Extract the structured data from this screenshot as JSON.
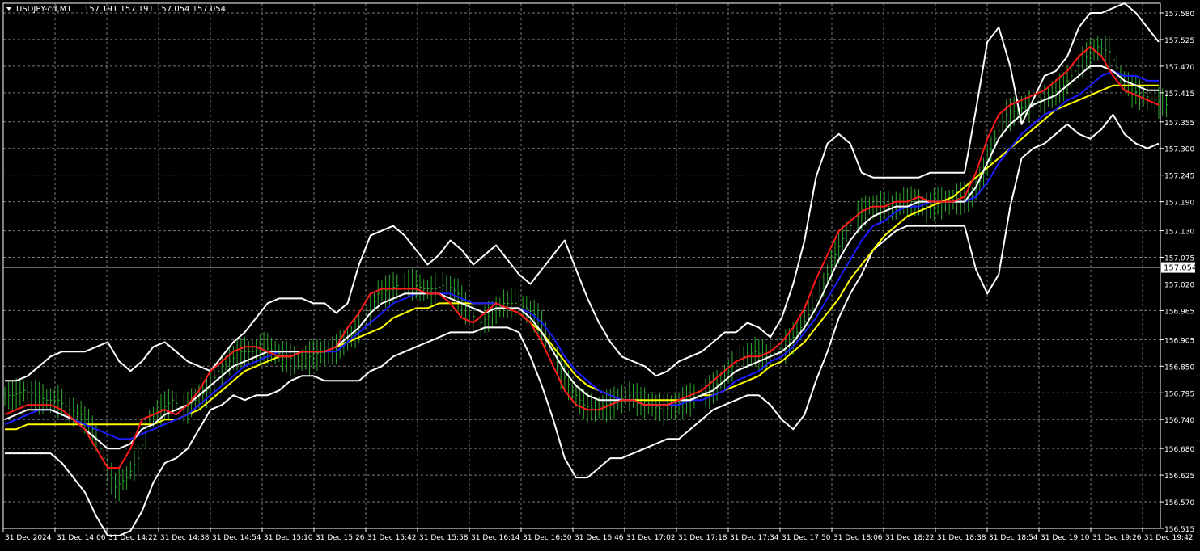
{
  "header": {
    "symbol": "USDJPY-cd,M1",
    "ohlc": "157.191 157.191 157.054 157.054"
  },
  "price_tag": "157.054",
  "colors": {
    "background": "#000000",
    "grid": "#7a7a7a",
    "candles": "#2fa82f",
    "ma_fast": "#ff1a1a",
    "ma_mid": "#ffffff",
    "ma_blue": "#1c1cff",
    "ma_slow": "#ffff00",
    "bands": "#ffffff",
    "axis_text": "#ffffff"
  },
  "chart_data": {
    "type": "line",
    "ylim": [
      156.515,
      157.6
    ],
    "y_ticks": [
      "157.580",
      "157.525",
      "157.470",
      "157.415",
      "157.355",
      "157.300",
      "157.245",
      "157.190",
      "157.130",
      "157.075",
      "157.020",
      "156.965",
      "156.905",
      "156.850",
      "156.795",
      "156.740",
      "156.680",
      "156.625",
      "156.570",
      "156.515"
    ],
    "x_ticks": [
      "31 Dec 2024",
      "31 Dec 14:06",
      "31 Dec 14:22",
      "31 Dec 14:38",
      "31 Dec 14:54",
      "31 Dec 15:10",
      "31 Dec 15:26",
      "31 Dec 15:42",
      "31 Dec 15:58",
      "31 Dec 16:14",
      "31 Dec 16:30",
      "31 Dec 16:46",
      "31 Dec 17:02",
      "31 Dec 17:18",
      "31 Dec 17:34",
      "31 Dec 17:50",
      "31 Dec 18:06",
      "31 Dec 18:22",
      "31 Dec 18:38",
      "31 Dec 18:54",
      "31 Dec 19:10",
      "31 Dec 19:26",
      "31 Dec 19:42"
    ],
    "current_price": 157.054,
    "grid": true,
    "series": [
      {
        "key": "close",
        "values": [
          156.79,
          156.8,
          156.79,
          156.78,
          156.78,
          156.76,
          156.75,
          156.72,
          156.66,
          156.6,
          156.62,
          156.66,
          156.74,
          156.76,
          156.78,
          156.76,
          156.78,
          156.8,
          156.84,
          156.86,
          156.88,
          156.88,
          156.89,
          156.88,
          156.87,
          156.86,
          156.87,
          156.88,
          156.88,
          156.9,
          156.92,
          156.95,
          157.0,
          157.01,
          157.02,
          157.02,
          157.01,
          157.01,
          157.02,
          157.0,
          156.96,
          156.94,
          156.96,
          156.98,
          156.98,
          156.97,
          156.95,
          156.9,
          156.84,
          156.8,
          156.77,
          156.76,
          156.77,
          156.78,
          156.79,
          156.78,
          156.77,
          156.76,
          156.77,
          156.78,
          156.79,
          156.8,
          156.82,
          156.85,
          156.87,
          156.88,
          156.87,
          156.88,
          156.9,
          156.93,
          156.97,
          157.02,
          157.08,
          157.13,
          157.16,
          157.18,
          157.18,
          157.18,
          157.19,
          157.19,
          157.18,
          157.19,
          157.19,
          157.2,
          157.2,
          157.25,
          157.32,
          157.37,
          157.38,
          157.39,
          157.4,
          157.41,
          157.43,
          157.46,
          157.49,
          157.51,
          157.5,
          157.45,
          157.42,
          157.41,
          157.4,
          157.39
        ]
      },
      {
        "key": "ma_fast",
        "name": "",
        "values": [
          156.75,
          156.76,
          156.77,
          156.77,
          156.77,
          156.76,
          156.74,
          156.72,
          156.68,
          156.64,
          156.64,
          156.68,
          156.74,
          156.75,
          156.76,
          156.75,
          156.77,
          156.8,
          156.84,
          156.86,
          156.88,
          156.89,
          156.89,
          156.88,
          156.87,
          156.87,
          156.88,
          156.88,
          156.88,
          156.89,
          156.93,
          156.96,
          157.0,
          157.01,
          157.01,
          157.01,
          157.01,
          157.0,
          157.0,
          156.98,
          156.95,
          156.94,
          156.96,
          156.98,
          156.97,
          156.96,
          156.94,
          156.9,
          156.85,
          156.8,
          156.77,
          156.76,
          156.76,
          156.77,
          156.78,
          156.78,
          156.77,
          156.77,
          156.77,
          156.78,
          156.79,
          156.8,
          156.82,
          156.84,
          156.86,
          156.87,
          156.87,
          156.88,
          156.9,
          156.93,
          156.97,
          157.03,
          157.08,
          157.13,
          157.15,
          157.17,
          157.18,
          157.18,
          157.19,
          157.19,
          157.2,
          157.19,
          157.19,
          157.19,
          157.2,
          157.25,
          157.32,
          157.37,
          157.39,
          157.4,
          157.41,
          157.42,
          157.44,
          157.46,
          157.49,
          157.51,
          157.49,
          157.45,
          157.42,
          157.41,
          157.4,
          157.39
        ]
      },
      {
        "key": "ma_mid",
        "name": "",
        "values": [
          156.74,
          156.75,
          156.76,
          156.76,
          156.76,
          156.75,
          156.74,
          156.72,
          156.7,
          156.68,
          156.68,
          156.69,
          156.72,
          156.73,
          156.75,
          156.76,
          156.77,
          156.79,
          156.81,
          156.83,
          156.85,
          156.86,
          156.87,
          156.88,
          156.88,
          156.88,
          156.88,
          156.88,
          156.88,
          156.89,
          156.91,
          156.93,
          156.96,
          156.98,
          156.99,
          157.0,
          157.0,
          157.0,
          157.0,
          156.99,
          156.98,
          156.97,
          156.96,
          156.97,
          156.97,
          156.97,
          156.95,
          156.92,
          156.88,
          156.84,
          156.81,
          156.79,
          156.78,
          156.78,
          156.78,
          156.78,
          156.77,
          156.77,
          156.77,
          156.78,
          156.78,
          156.79,
          156.8,
          156.82,
          156.84,
          156.85,
          156.86,
          156.87,
          156.88,
          156.9,
          156.93,
          156.97,
          157.02,
          157.07,
          157.11,
          157.14,
          157.16,
          157.17,
          157.18,
          157.18,
          157.19,
          157.19,
          157.19,
          157.19,
          157.19,
          157.22,
          157.27,
          157.32,
          157.35,
          157.37,
          157.39,
          157.4,
          157.41,
          157.43,
          157.45,
          157.47,
          157.47,
          157.46,
          157.44,
          157.43,
          157.42,
          157.42
        ]
      },
      {
        "key": "ma_blue",
        "name": "",
        "values": [
          156.73,
          156.74,
          156.75,
          156.76,
          156.76,
          156.75,
          156.74,
          156.73,
          156.72,
          156.71,
          156.7,
          156.7,
          156.71,
          156.72,
          156.73,
          156.74,
          156.75,
          156.77,
          156.79,
          156.81,
          156.83,
          156.85,
          156.86,
          156.87,
          156.88,
          156.88,
          156.88,
          156.88,
          156.88,
          156.88,
          156.9,
          156.92,
          156.94,
          156.96,
          156.98,
          156.99,
          157.0,
          157.0,
          157.0,
          157.0,
          156.99,
          156.98,
          156.98,
          156.98,
          156.97,
          156.97,
          156.96,
          156.94,
          156.91,
          156.87,
          156.84,
          156.82,
          156.8,
          156.79,
          156.78,
          156.78,
          156.77,
          156.77,
          156.77,
          156.77,
          156.78,
          156.78,
          156.79,
          156.8,
          156.82,
          156.83,
          156.84,
          156.86,
          156.87,
          156.89,
          156.92,
          156.95,
          156.99,
          157.03,
          157.07,
          157.11,
          157.14,
          157.15,
          157.17,
          157.18,
          157.18,
          157.19,
          157.19,
          157.19,
          157.19,
          157.2,
          157.23,
          157.27,
          157.3,
          157.33,
          157.35,
          157.37,
          157.38,
          157.4,
          157.41,
          157.43,
          157.45,
          157.46,
          157.45,
          157.45,
          157.44,
          157.44
        ]
      },
      {
        "key": "ma_slow",
        "name": "",
        "values": [
          156.72,
          156.72,
          156.73,
          156.73,
          156.73,
          156.73,
          156.73,
          156.73,
          156.73,
          156.73,
          156.73,
          156.73,
          156.73,
          156.73,
          156.74,
          156.74,
          156.75,
          156.76,
          156.78,
          156.8,
          156.82,
          156.84,
          156.85,
          156.86,
          156.87,
          156.87,
          156.88,
          156.88,
          156.88,
          156.89,
          156.9,
          156.91,
          156.92,
          156.93,
          156.95,
          156.96,
          156.97,
          156.97,
          156.98,
          156.98,
          156.98,
          156.98,
          156.98,
          156.98,
          156.97,
          156.96,
          156.94,
          156.92,
          156.89,
          156.86,
          156.83,
          156.81,
          156.8,
          156.79,
          156.78,
          156.78,
          156.78,
          156.78,
          156.78,
          156.78,
          156.78,
          156.79,
          156.79,
          156.8,
          156.81,
          156.82,
          156.83,
          156.85,
          156.86,
          156.88,
          156.9,
          156.93,
          156.96,
          156.99,
          157.03,
          157.06,
          157.09,
          157.12,
          157.14,
          157.16,
          157.17,
          157.18,
          157.19,
          157.2,
          157.22,
          157.24,
          157.26,
          157.28,
          157.3,
          157.32,
          157.34,
          157.36,
          157.38,
          157.39,
          157.4,
          157.41,
          157.42,
          157.43,
          157.43,
          157.43,
          157.43,
          157.43
        ]
      },
      {
        "key": "band_upper",
        "name": "",
        "values": [
          156.82,
          156.82,
          156.83,
          156.85,
          156.87,
          156.88,
          156.88,
          156.88,
          156.89,
          156.9,
          156.86,
          156.84,
          156.86,
          156.89,
          156.9,
          156.88,
          156.86,
          156.85,
          156.84,
          156.87,
          156.9,
          156.92,
          156.95,
          156.98,
          156.99,
          156.99,
          156.99,
          156.98,
          156.98,
          156.96,
          156.98,
          157.06,
          157.12,
          157.13,
          157.14,
          157.12,
          157.09,
          157.06,
          157.08,
          157.11,
          157.09,
          157.06,
          157.08,
          157.1,
          157.07,
          157.04,
          157.02,
          157.05,
          157.08,
          157.11,
          157.05,
          156.99,
          156.94,
          156.9,
          156.87,
          156.86,
          156.85,
          156.83,
          156.84,
          156.86,
          156.87,
          156.88,
          156.9,
          156.92,
          156.92,
          156.94,
          156.93,
          156.91,
          156.95,
          157.02,
          157.11,
          157.24,
          157.31,
          157.33,
          157.31,
          157.25,
          157.24,
          157.24,
          157.24,
          157.24,
          157.24,
          157.25,
          157.25,
          157.25,
          157.25,
          157.38,
          157.52,
          157.55,
          157.47,
          157.35,
          157.4,
          157.45,
          157.46,
          157.49,
          157.55,
          157.58,
          157.58,
          157.59,
          157.6,
          157.58,
          157.55,
          157.52
        ]
      },
      {
        "key": "band_lower",
        "name": "",
        "values": [
          156.67,
          156.67,
          156.67,
          156.67,
          156.67,
          156.65,
          156.62,
          156.59,
          156.54,
          156.5,
          156.5,
          156.51,
          156.55,
          156.61,
          156.65,
          156.66,
          156.68,
          156.72,
          156.76,
          156.77,
          156.79,
          156.78,
          156.79,
          156.79,
          156.8,
          156.82,
          156.83,
          156.83,
          156.82,
          156.82,
          156.82,
          156.82,
          156.84,
          156.85,
          156.87,
          156.88,
          156.89,
          156.9,
          156.91,
          156.92,
          156.92,
          156.92,
          156.93,
          156.93,
          156.93,
          156.92,
          156.87,
          156.81,
          156.74,
          156.66,
          156.62,
          156.62,
          156.64,
          156.66,
          156.66,
          156.67,
          156.68,
          156.69,
          156.7,
          156.7,
          156.72,
          156.74,
          156.76,
          156.77,
          156.78,
          156.79,
          156.79,
          156.77,
          156.74,
          156.72,
          156.75,
          156.82,
          156.88,
          156.95,
          157.0,
          157.04,
          157.09,
          157.11,
          157.13,
          157.14,
          157.14,
          157.14,
          157.14,
          157.14,
          157.14,
          157.05,
          157.0,
          157.04,
          157.18,
          157.28,
          157.3,
          157.31,
          157.33,
          157.35,
          157.33,
          157.32,
          157.34,
          157.37,
          157.33,
          157.31,
          157.3,
          157.31
        ]
      }
    ]
  }
}
